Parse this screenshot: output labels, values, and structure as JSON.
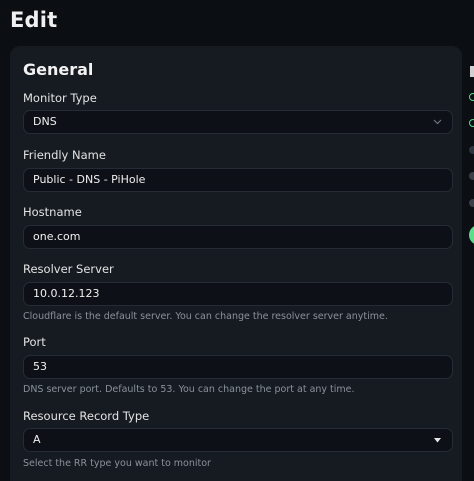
{
  "header": {
    "title": "Edit"
  },
  "form": {
    "section_title": "General",
    "monitor_type": {
      "label": "Monitor Type",
      "value": "DNS"
    },
    "friendly_name": {
      "label": "Friendly Name",
      "value": "Public - DNS - PiHole"
    },
    "hostname": {
      "label": "Hostname",
      "value": "one.com"
    },
    "resolver_server": {
      "label": "Resolver Server",
      "value": "10.0.12.123",
      "hint": "Cloudflare is the default server. You can change the resolver server anytime."
    },
    "port": {
      "label": "Port",
      "value": "53",
      "hint": "DNS server port. Defaults to 53. You can change the port at any time."
    },
    "resource_record_type": {
      "label": "Resource Record Type",
      "value": "A",
      "hint": "Select the RR type you want to monitor"
    }
  },
  "colors": {
    "background": "#0b0e13",
    "card": "#161b22",
    "input": "#0d1117",
    "accent_green": "#5cdd8b"
  }
}
